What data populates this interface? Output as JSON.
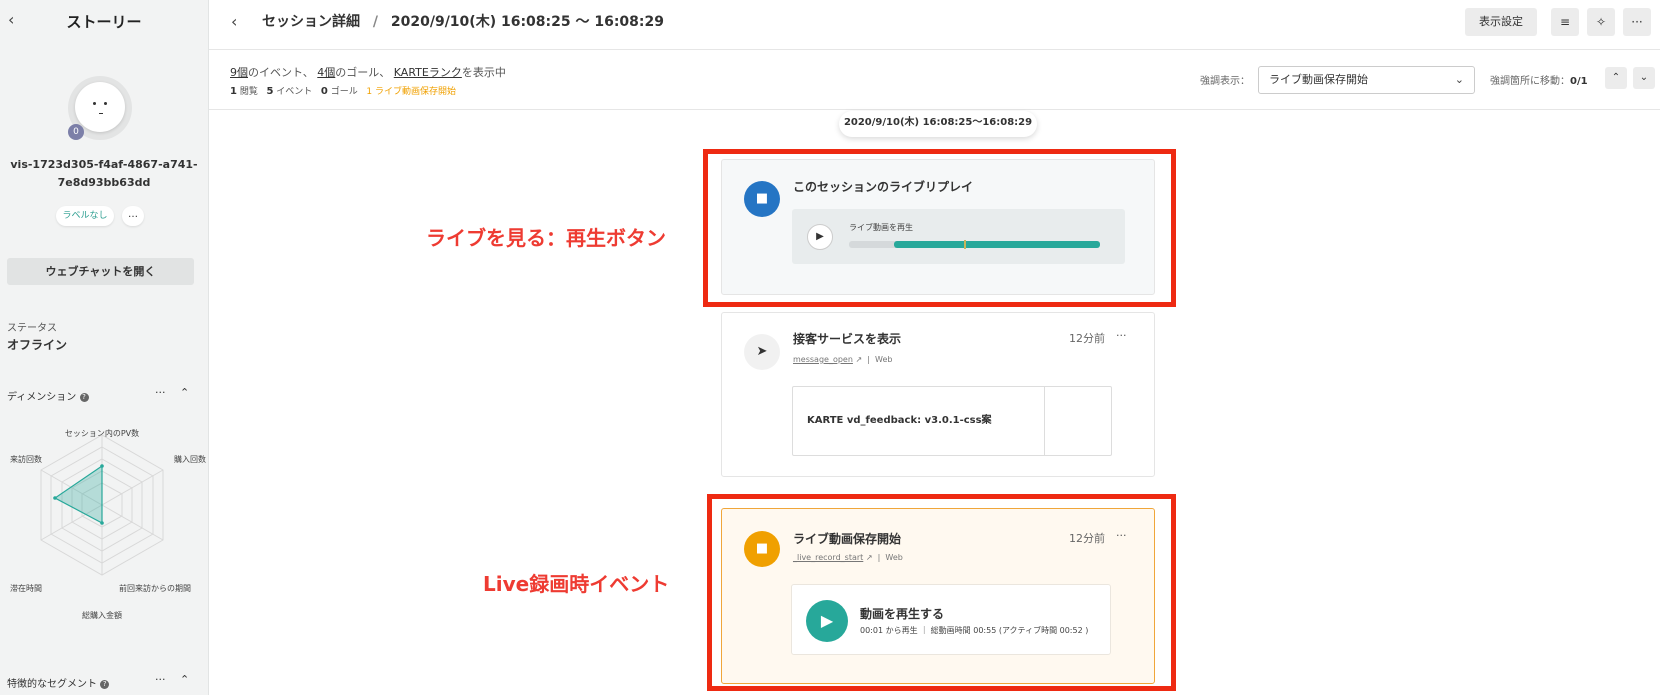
{
  "sidebar": {
    "title": "ストーリー",
    "avatar_badge": "0",
    "visitor_id": "vis-1723d305-f4af-4867-a741-7e8d93bb63dd",
    "label_chip": "ラベルなし",
    "more": "…",
    "webchat_button": "ウェブチャットを開く",
    "status_label": "ステータス",
    "status_value": "オフライン",
    "dimension_heading": "ディメンション",
    "radar_labels": {
      "top": "セッション内のPV数",
      "top_right": "購入回数",
      "top_left": "来訪回数",
      "bottom_right": "前回来訪からの期間",
      "bottom_left": "滞在時間",
      "bottom": "総購入金額"
    },
    "segment_heading": "特徴的なセグメント"
  },
  "header": {
    "title": "セッション詳細",
    "separator": "/",
    "range": "2020/9/10(木) 16:08:25 〜 16:08:29",
    "display_settings": "表示設定"
  },
  "summary": {
    "events_link": "9個",
    "events_suffix": "のイベント、",
    "goals_link": "4個",
    "goals_suffix": "のゴール、",
    "rank_link": "KARTEランク",
    "rank_suffix": "を表示中",
    "pv_count": "1",
    "pv_label": "閲覧",
    "event_count": "5",
    "event_label": "イベント",
    "goal_count": "0",
    "goal_label": "ゴール",
    "highlight_count_text": "1 ライブ動画保存開始",
    "highlight_label": "強調表示：",
    "highlight_value": "ライブ動画保存開始",
    "move_label": "強調箇所に移動：",
    "move_value": "0/1"
  },
  "timeline": {
    "date_pill": "2020/9/10(木) 16:08:25〜16:08:29",
    "replay": {
      "title": "このセッションのライブリプレイ",
      "player_label": "ライブ動画を再生",
      "played_fraction": 0.18,
      "buffered_fraction": 1.0,
      "marker_fraction": 0.46
    },
    "service": {
      "title": "接客サービスを表示",
      "time_ago": "12分前",
      "event_name": "message_open",
      "channel": "Web",
      "message_title": "KARTE vd_feedback: v3.0.1-css案"
    },
    "live": {
      "title": "ライブ動画保存開始",
      "time_ago": "12分前",
      "event_name": "_live_record_start",
      "channel": "Web",
      "video_title": "動画を再生する",
      "video_sub": "00:01 から再生 ｜ 総動画時間 00:55 (アクティブ時間 00:52 )"
    }
  },
  "annotations": {
    "replay_note": "ライブを見る：再生ボタン",
    "live_note": "Live録画時イベント"
  },
  "colors": {
    "accent_teal": "#27a89a",
    "replay_icon": "#2575c4",
    "live_icon": "#f0a000",
    "annotation_red": "#ee2a12"
  }
}
